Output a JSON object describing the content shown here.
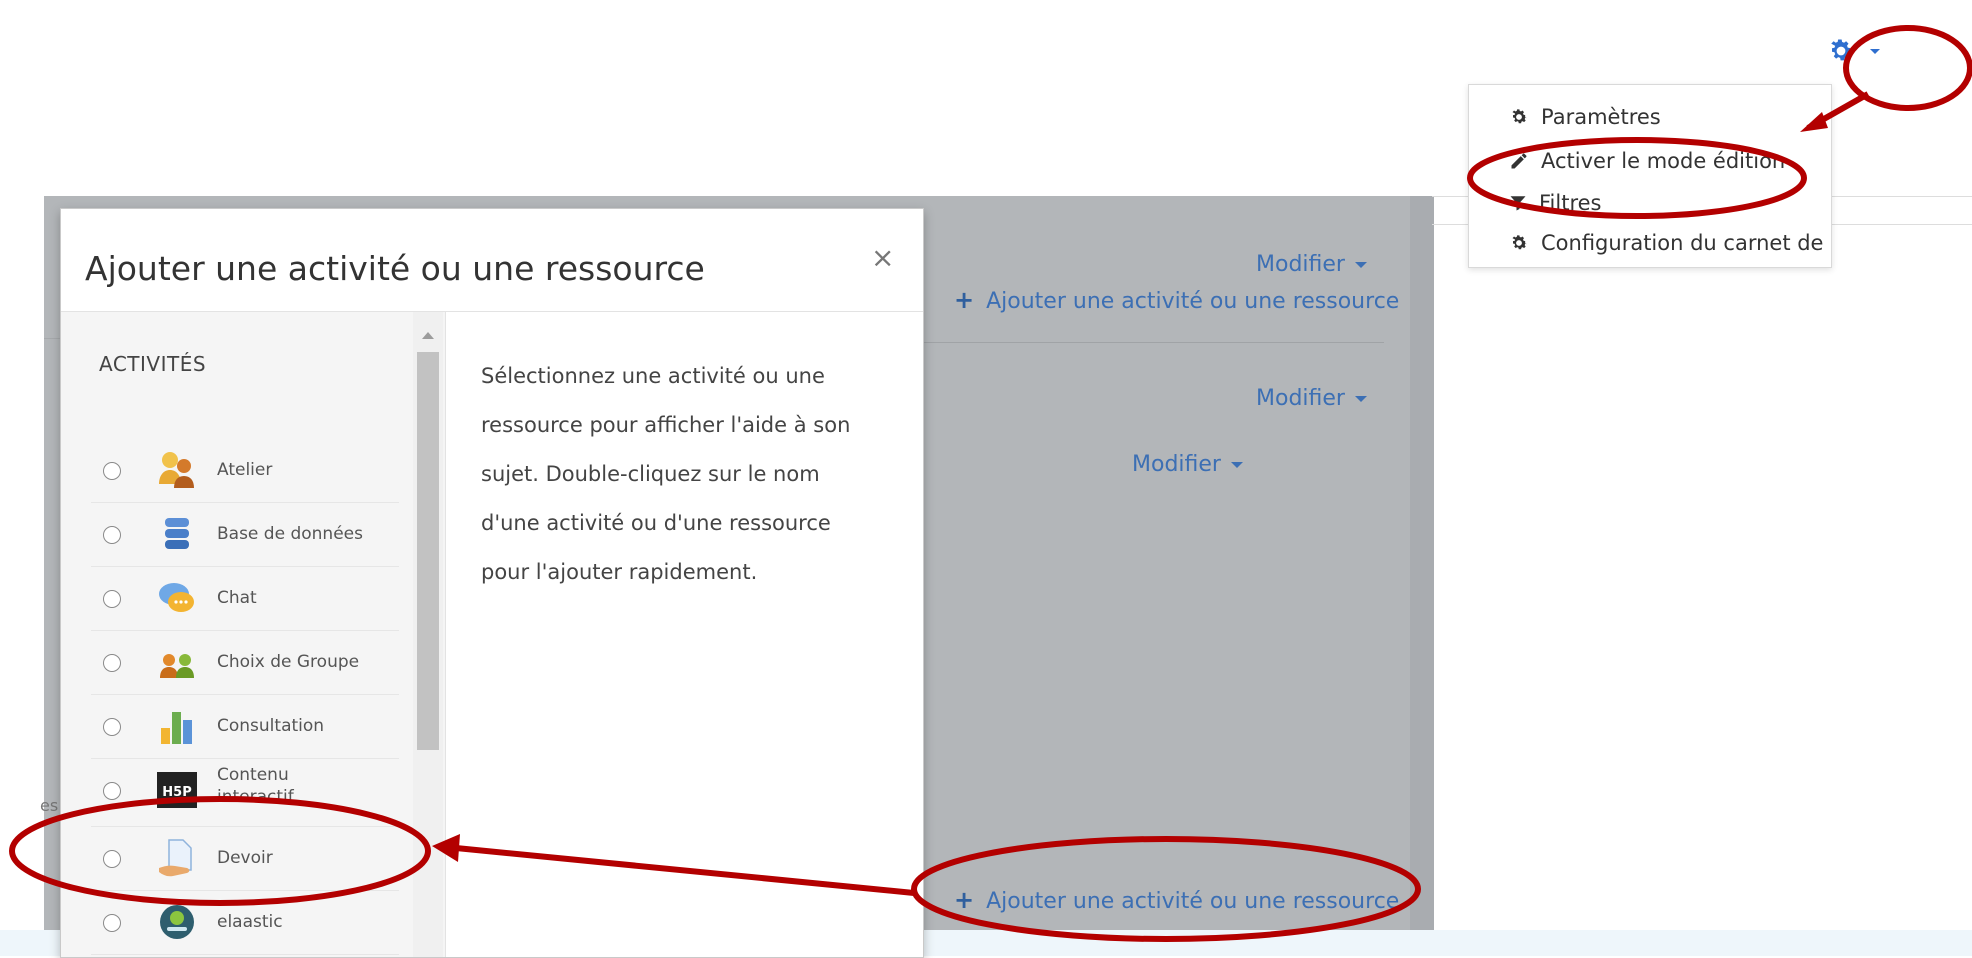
{
  "admin_menu": {
    "items": [
      {
        "label": "Paramètres",
        "icon": "gear-icon"
      },
      {
        "label": "Activer le mode édition",
        "icon": "pencil-icon"
      },
      {
        "label": "Filtres",
        "icon": "filter-icon"
      },
      {
        "label": "Configuration du carnet de notes",
        "icon": "gear-icon"
      }
    ]
  },
  "course": {
    "modify_label": "Modifier",
    "add_activity_label": "Ajouter une activité ou une ressource",
    "side_text": "es"
  },
  "modal": {
    "title": "Ajouter une activité ou une ressource",
    "close": "×",
    "section_heading": "ACTIVITÉS",
    "help_text": "Sélectionnez une activité ou une ressource pour afficher l'aide à son sujet. Double-cliquez sur le nom d'une activité ou d'une ressource pour l'ajouter rapidement.",
    "activities": [
      {
        "label": "Atelier",
        "icon": "workshop-icon"
      },
      {
        "label": "Base de données",
        "icon": "database-icon"
      },
      {
        "label": "Chat",
        "icon": "chat-icon"
      },
      {
        "label": "Choix de Groupe",
        "icon": "group-choice-icon"
      },
      {
        "label": "Consultation",
        "icon": "consultation-icon"
      },
      {
        "label": "Contenu interactif",
        "icon": "h5p-icon"
      },
      {
        "label": "Devoir",
        "icon": "assignment-icon"
      },
      {
        "label": "elaastic",
        "icon": "elaastic-icon"
      }
    ]
  },
  "colors": {
    "link": "#3c6fb4",
    "gear": "#2f6fcf",
    "annotation": "#b30000",
    "overlay": "#b3b6b9"
  }
}
